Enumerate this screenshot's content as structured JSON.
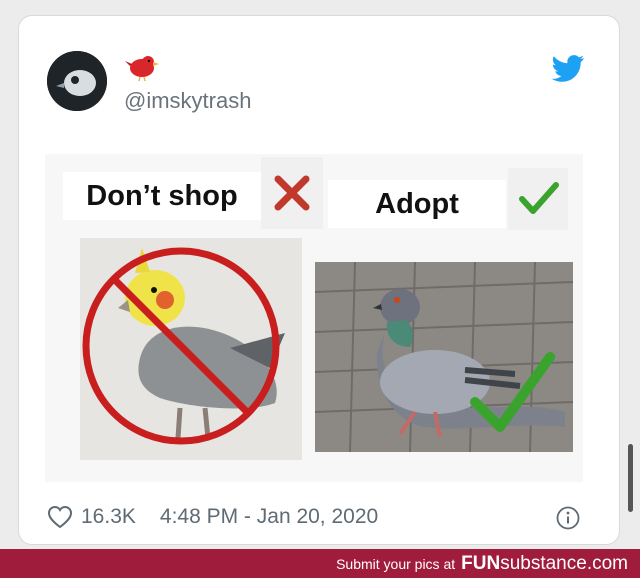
{
  "tweet": {
    "handle": "@imskytrash",
    "likes": "16.3K",
    "timestamp": "4:48 PM - Jan 20, 2020"
  },
  "meme": {
    "left_label": "Don’t shop",
    "right_label": "Adopt"
  },
  "watermark": {
    "prefix": "Submit your pics at",
    "brand_bold": "FUN",
    "brand_rest": "substance.com"
  },
  "colors": {
    "twitter_blue": "#1da1f2",
    "footer_bar": "#a01c3c",
    "prohibition_red": "#c81e1e",
    "check_green": "#3aa32e"
  },
  "icons": [
    "bird-avatar-icon",
    "red-bird-emoji-icon",
    "twitter-logo-icon",
    "x-icon",
    "check-icon",
    "heart-icon",
    "info-icon"
  ]
}
